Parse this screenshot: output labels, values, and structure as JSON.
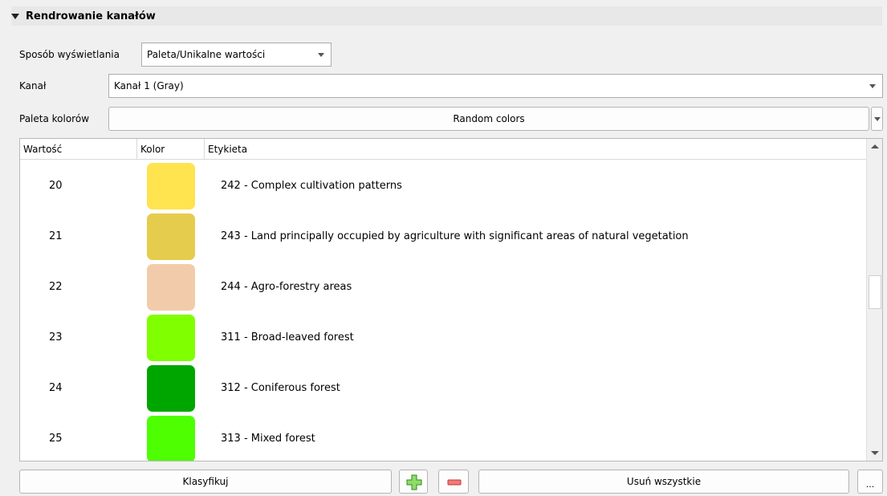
{
  "section": {
    "title": "Rendrowanie kanałów"
  },
  "render_type": {
    "label": "Sposób wyświetlania",
    "value": "Paleta/Unikalne wartości"
  },
  "band": {
    "label": "Kanał",
    "value": "Kanał 1 (Gray)"
  },
  "palette": {
    "label": "Paleta kolorów",
    "value": "Random colors"
  },
  "table": {
    "headers": [
      "Wartość",
      "Kolor",
      "Etykieta"
    ],
    "rows": [
      {
        "value": "20",
        "color": "#ffe34f",
        "label": "242 - Complex cultivation patterns"
      },
      {
        "value": "21",
        "color": "#e6cc4d",
        "label": "243 - Land principally occupied by agriculture with significant areas of natural vegetation"
      },
      {
        "value": "22",
        "color": "#f2ccaa",
        "label": "244 - Agro-forestry areas"
      },
      {
        "value": "23",
        "color": "#80ff00",
        "label": "311 - Broad-leaved forest"
      },
      {
        "value": "24",
        "color": "#00a600",
        "label": "312 - Coniferous forest"
      },
      {
        "value": "25",
        "color": "#4dff00",
        "label": "313 - Mixed forest"
      }
    ]
  },
  "buttons": {
    "classify": "Klasyfikuj",
    "delete_all": "Usuń wszystkie",
    "more": "..."
  },
  "icons": {
    "add": "plus-icon",
    "remove": "minus-icon",
    "expand": "triangle-down-icon"
  }
}
